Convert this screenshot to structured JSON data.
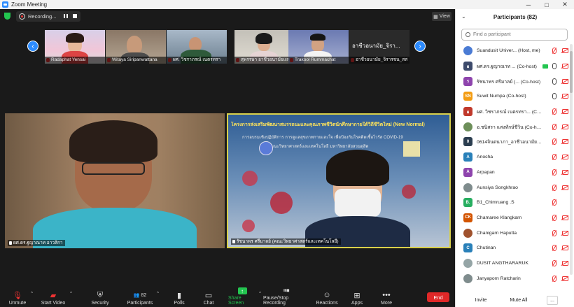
{
  "window": {
    "title": "Zoom Meeting",
    "minimize": "─",
    "maximize": "□",
    "close": "✕"
  },
  "topbar": {
    "recording": "Recording...",
    "view": "View"
  },
  "thumbs": [
    {
      "name": "Radaphat Yensai"
    },
    {
      "name": "Witaya Siripanwattana"
    },
    {
      "name": "ผศ. วิชราภรณ์ เนตรทรา"
    },
    {
      "name": "สุพรรษา อาชีวอนามัยและฯ"
    },
    {
      "name": "Trakool Rummachat"
    },
    {
      "name": "อาชีวอนามัย_จิรารชน_สส",
      "display": "อาชีวอนามัย_จิรา..."
    }
  ],
  "tiles": {
    "left_name": "ผศ.ดร.ฐญาณาท อาวสิกา",
    "right_name": "รัชนาพร ศรีมาลย์ (คณะวิทยาศาสตร์และเทคโนโลยี)",
    "slide_title": "โครงการส่งเสริมพัฒนาสมรรถนะและคุณภาพชีวิตนักศึกษากายใต้วิถีชีวิตใหม่ (New Normal)",
    "slide_sub1": "การอบรมเชิงปฏิบัติการ การดูแลสุขภาพกายและใจ เพื่อป้องกันโรคติดเชื้อไวรัส COVID-19",
    "slide_sub2": "คณะวิทยาศาสตร์และเทคโนโลยี มหาวิทยาลัยสวนดุสิต"
  },
  "toolbar": {
    "unmute": "Unmute",
    "start_video": "Start Video",
    "security": "Security",
    "participants": "Participants",
    "participants_count": "82",
    "polls": "Polls",
    "chat": "Chat",
    "share": "Share Screen",
    "pause_rec": "Pause/Stop Recording",
    "reactions": "Reactions",
    "apps": "Apps",
    "more": "More",
    "end": "End"
  },
  "panel": {
    "title": "Participants (82)",
    "search_placeholder": "Find a participant",
    "invite": "Invite",
    "mute_all": "Mute All",
    "more": "...",
    "people": [
      {
        "name": "Suandusit Univer... (Host, me)",
        "av": "",
        "color": "#4a7bd4",
        "mic": "off",
        "vid": "off"
      },
      {
        "name": "ผศ.ดร.ฐญาณาท ... (Co-host)",
        "av": "ผ",
        "color": "#3d4a6b",
        "mic": "on",
        "vid": "off",
        "extra": true
      },
      {
        "name": "รัชนาพร ศรีมาลย์ (... (Co-host)",
        "av": "ร",
        "color": "#8e44ad",
        "mic": "on",
        "vid": "off"
      },
      {
        "name": "Suwit Numpa (Co-host)",
        "av": "SN",
        "color": "#f39c12",
        "mic": "on",
        "vid": "off"
      },
      {
        "name": "ผศ. วิชราภรณ์ เนตรทรา... (Co-host)",
        "av": "ผ",
        "color": "#c0392b",
        "mic": "off",
        "vid": "off"
      },
      {
        "name": "อ.ชนิสรา แสงทักษ์ชีวิน (Co-host)",
        "av": "",
        "color": "#6d8f5a",
        "mic": "off",
        "vid": "off"
      },
      {
        "name": "0614จินตนาภา_อาชีวอนามัยและความปลอ...",
        "av": "0",
        "color": "#2c3e50",
        "mic": "off",
        "vid": "off"
      },
      {
        "name": "Anocha",
        "av": "A",
        "color": "#2980b9",
        "mic": "off",
        "vid": "off"
      },
      {
        "name": "Arpapan",
        "av": "A",
        "color": "#8e44ad",
        "mic": "off",
        "vid": "off"
      },
      {
        "name": "Aunsiya Songkhrao",
        "av": "",
        "color": "#7f8c8d",
        "mic": "off",
        "vid": "off"
      },
      {
        "name": "B1_Chimruang .S",
        "av": "B.",
        "color": "#27ae60",
        "mic": "off",
        "vid": ""
      },
      {
        "name": "Chamaree Klangkarn",
        "av": "CK",
        "color": "#d35400",
        "mic": "off",
        "vid": "off"
      },
      {
        "name": "Chanigarn Haputta",
        "av": "",
        "color": "#a0522d",
        "mic": "off",
        "vid": "off"
      },
      {
        "name": "Chutinan",
        "av": "C",
        "color": "#2980b9",
        "mic": "off",
        "vid": "off"
      },
      {
        "name": "DUSIT ANGTHARARUK",
        "av": "",
        "color": "#95a5a6",
        "mic": "off",
        "vid": "off"
      },
      {
        "name": "Janyaporn Ratcharin",
        "av": "",
        "color": "#7f8c8d",
        "mic": "off",
        "vid": "off"
      }
    ]
  }
}
